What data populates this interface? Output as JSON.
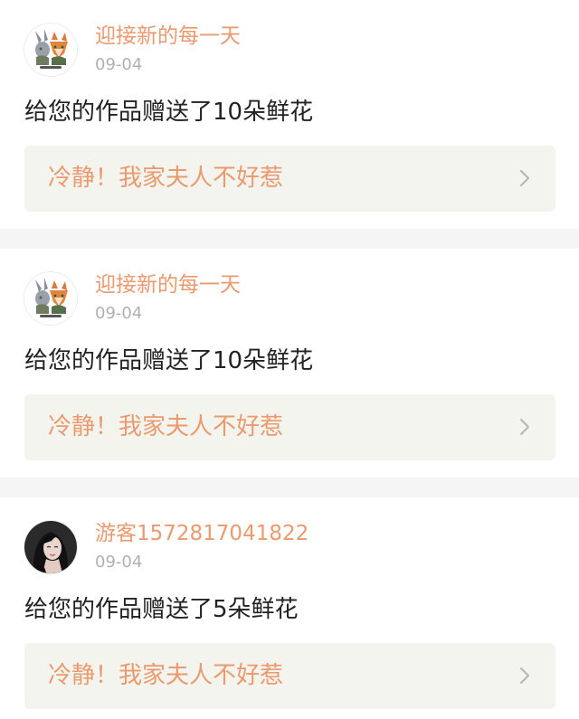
{
  "notifications": [
    {
      "username": "迎接新的每一天",
      "avatar_icon": "fox-rabbit-avatar",
      "date": "09-04",
      "message": "给您的作品赠送了10朵鲜花",
      "work_title": "冷静！我家夫人不好惹"
    },
    {
      "username": "迎接新的每一天",
      "avatar_icon": "fox-rabbit-avatar",
      "date": "09-04",
      "message": "给您的作品赠送了10朵鲜花",
      "work_title": "冷静！我家夫人不好惹"
    },
    {
      "username": "游客1572817041822",
      "avatar_icon": "woman-portrait-avatar",
      "date": "09-04",
      "message": "给您的作品赠送了5朵鲜花",
      "work_title": "冷静！我家夫人不好惹"
    }
  ],
  "colors": {
    "accent": "#ea9a6e",
    "date": "#b0b0b0",
    "text": "#222222",
    "card_link_bg": "#f4f4ee",
    "separator": "#f5f5f5"
  }
}
